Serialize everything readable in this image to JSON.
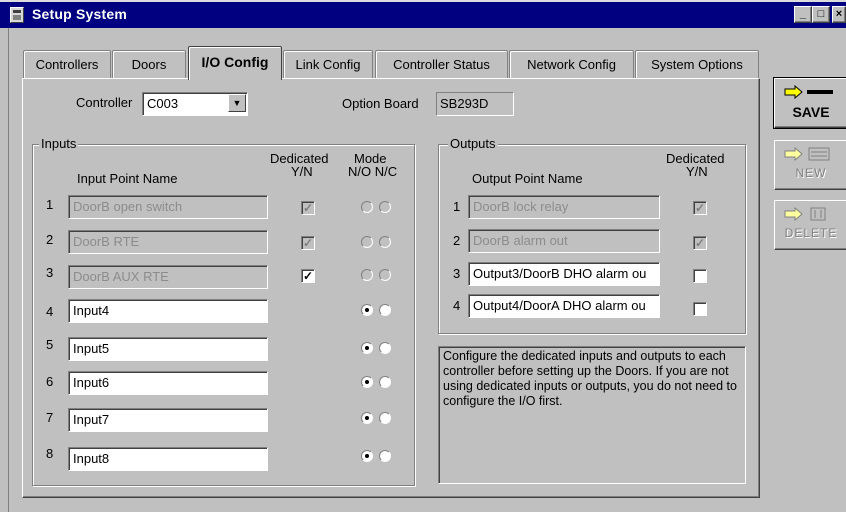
{
  "window": {
    "title": "Setup System",
    "buttons": {
      "minimize": "_",
      "maximize": "□",
      "close": "×"
    }
  },
  "tabs": [
    {
      "label": "Controllers",
      "active": false
    },
    {
      "label": "Doors",
      "active": false
    },
    {
      "label": "I/O Config",
      "active": true
    },
    {
      "label": "Link Config",
      "active": false
    },
    {
      "label": "Controller Status",
      "active": false
    },
    {
      "label": "Network Config",
      "active": false
    },
    {
      "label": "System Options",
      "active": false
    }
  ],
  "controller": {
    "label": "Controller",
    "value": "C003",
    "dropdown_glyph": "▼"
  },
  "option_board": {
    "label": "Option Board",
    "value": "SB293D"
  },
  "inputs": {
    "group_title": "Inputs",
    "col_name": "Input Point Name",
    "col_dedicated_1": "Dedicated",
    "col_dedicated_2": "Y/N",
    "col_mode_1": "Mode",
    "col_mode_2": "N/O N/C",
    "rows": [
      {
        "num": "1",
        "name": "DoorB open switch",
        "dedicated_shown": true,
        "dedicated": true,
        "mode": "none",
        "disabled": true
      },
      {
        "num": "2",
        "name": "DoorB RTE",
        "dedicated_shown": true,
        "dedicated": true,
        "mode": "none",
        "disabled": true
      },
      {
        "num": "3",
        "name": "DoorB AUX RTE",
        "dedicated_shown": true,
        "dedicated": true,
        "mode": "none",
        "disabled": true,
        "dedicated_enabled": true
      },
      {
        "num": "4",
        "name": "Input4",
        "dedicated_shown": false,
        "mode": "NO",
        "disabled": false
      },
      {
        "num": "5",
        "name": "Input5",
        "dedicated_shown": false,
        "mode": "NO",
        "disabled": false
      },
      {
        "num": "6",
        "name": "Input6",
        "dedicated_shown": false,
        "mode": "NO",
        "disabled": false
      },
      {
        "num": "7",
        "name": "Input7",
        "dedicated_shown": false,
        "mode": "NO",
        "disabled": false
      },
      {
        "num": "8",
        "name": "Input8",
        "dedicated_shown": false,
        "mode": "NO",
        "disabled": false
      }
    ],
    "check_glyph": "✓"
  },
  "outputs": {
    "group_title": "Outputs",
    "col_name": "Output Point Name",
    "col_dedicated_1": "Dedicated",
    "col_dedicated_2": "Y/N",
    "rows": [
      {
        "num": "1",
        "name": "DoorB lock relay",
        "dedicated": true,
        "disabled": true
      },
      {
        "num": "2",
        "name": "DoorB alarm out",
        "dedicated": true,
        "disabled": true
      },
      {
        "num": "3",
        "name": "Output3/DoorB DHO alarm ou",
        "dedicated": false,
        "disabled": false
      },
      {
        "num": "4",
        "name": "Output4/DoorA DHO alarm ou",
        "dedicated": false,
        "disabled": false
      }
    ]
  },
  "info_text": "Configure the dedicated inputs and outputs to each controller before setting up the Doors.  If you are not using dedicated inputs or outputs, you do not need to configure the I/O first.",
  "side_buttons": [
    {
      "label": "SAVE",
      "icon": "save-arrow-icon",
      "enabled": true
    },
    {
      "label": "NEW",
      "icon": "new-arrow-icon",
      "enabled": false
    },
    {
      "label": "DELETE",
      "icon": "delete-arrow-icon",
      "enabled": false
    }
  ],
  "colors": {
    "titlebar": "#000080",
    "face": "#c0c0c0",
    "arrow": "#ffff00"
  }
}
